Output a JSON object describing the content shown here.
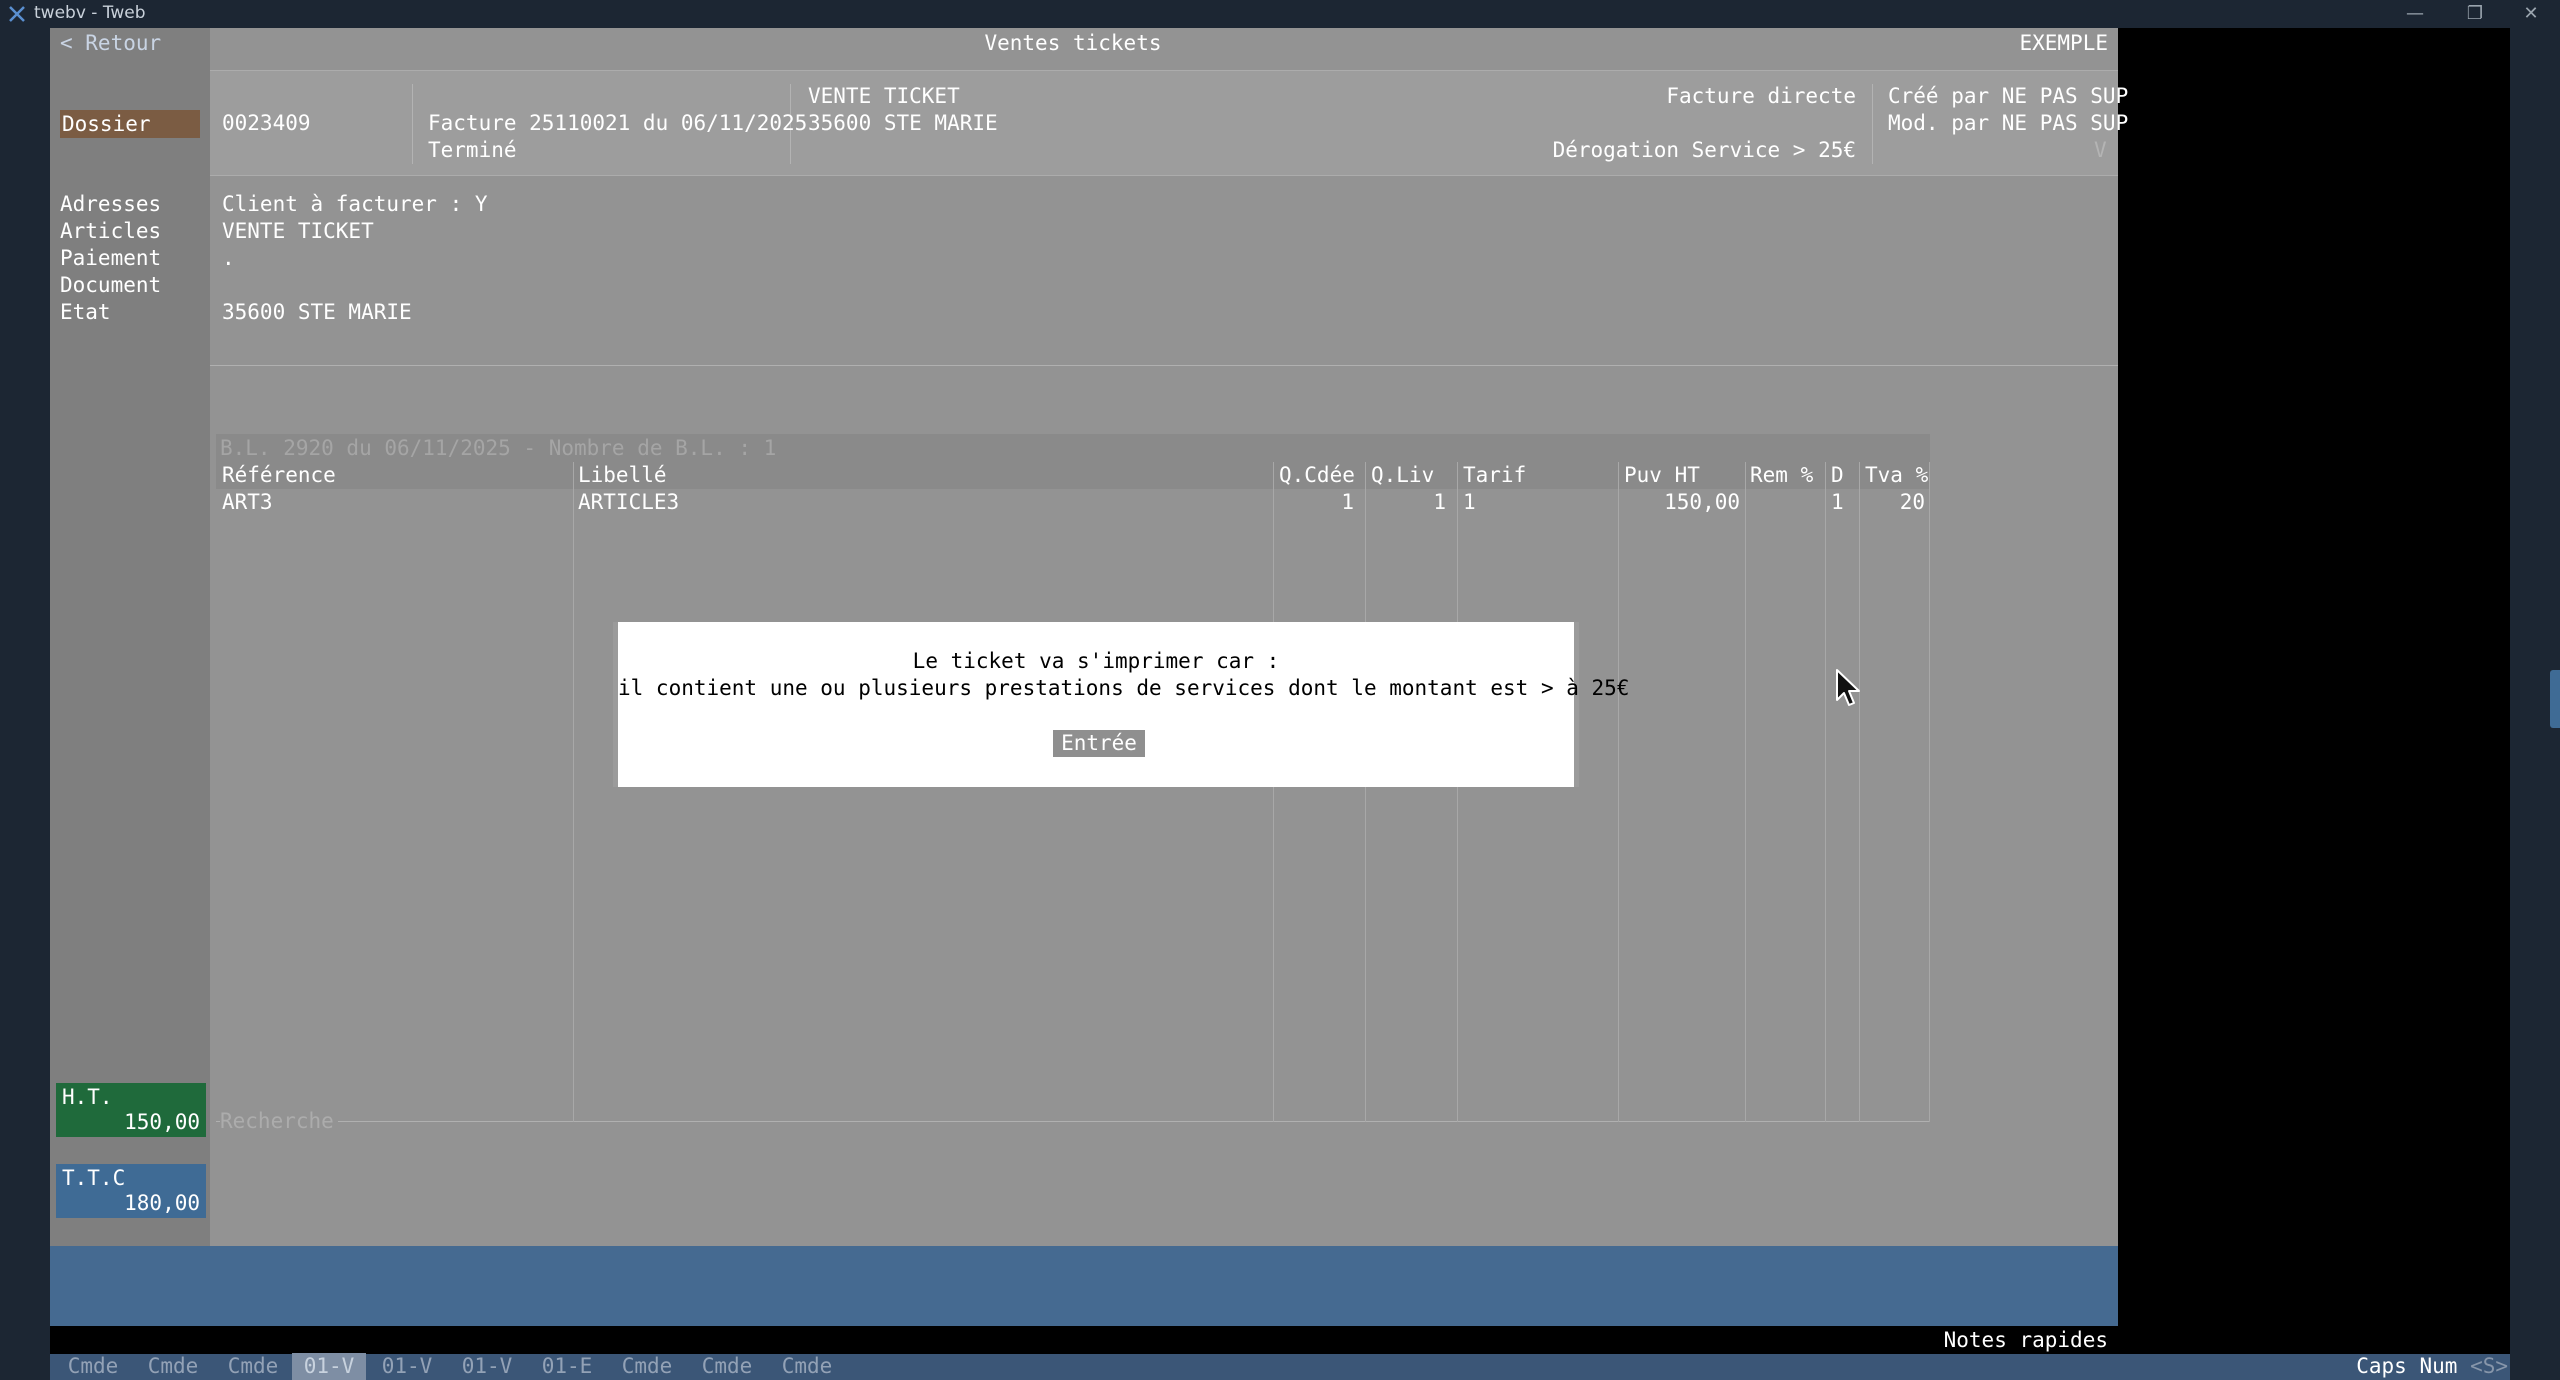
{
  "window": {
    "title": "twebv - Tweb",
    "minimize": "—",
    "maximize": "❐",
    "close": "✕"
  },
  "header": {
    "back": "< Retour",
    "title": "Ventes tickets",
    "mode": "EXEMPLE"
  },
  "dossier": {
    "label": "Dossier",
    "number": "0023409",
    "invoice": "Facture 25110021 du 06/11/2025",
    "status": "Terminé",
    "client_name": "VENTE TICKET",
    "client_city": "35600 STE MARIE",
    "invoice_type": "Facture directe",
    "derogation": "Dérogation Service > 25€",
    "created_by": "Créé par NE PAS SUP",
    "modified_by": "Mod. par NE PAS SUP",
    "corner_mark": "V"
  },
  "info": {
    "labels": [
      "Adresses",
      "Articles",
      "Paiement",
      "Document",
      "Etat"
    ],
    "values": [
      "Client à facturer : Y",
      "VENTE TICKET",
      ".",
      "",
      "35600 STE MARIE"
    ]
  },
  "table": {
    "caption": "B.L. 2920 du 06/11/2025 - Nombre de B.L. : 1",
    "columns": [
      "Référence",
      "Libellé",
      "Q.Cdée",
      "Q.Liv",
      "Tarif",
      "Puv HT",
      "Rem %",
      "D",
      "Tva %"
    ],
    "rows": [
      {
        "ref": "ART3",
        "label": "ARTICLE3",
        "qcde": "1",
        "qliv": "1",
        "tarif": "1",
        "puv": "150,00",
        "rem": "",
        "d": "1",
        "tva": "20"
      }
    ],
    "search_placeholder": "Recherche"
  },
  "totals": {
    "ht_label": "H.T.",
    "ht_value": "150,00",
    "ttc_label": "T.T.C",
    "ttc_value": "180,00"
  },
  "dialog": {
    "line1": "Le ticket va s'imprimer car :",
    "line2": "il contient une ou plusieurs prestations de services dont le montant est > à 25€",
    "button": "Entrée"
  },
  "footer": {
    "notes": "Notes rapides",
    "commands": [
      "Cmde",
      "Cmde",
      "Cmde",
      "01-V",
      "01-V",
      "01-V",
      "01-E",
      "Cmde",
      "Cmde",
      "Cmde"
    ],
    "active_command_index": 3,
    "status": "Caps Num",
    "status_dim": "<S>"
  },
  "colors": {
    "accent_green": "#1f6a3b",
    "accent_blue": "#3f6b95",
    "dossier_tag": "#7b5c43",
    "panel_gray": "#939393"
  }
}
